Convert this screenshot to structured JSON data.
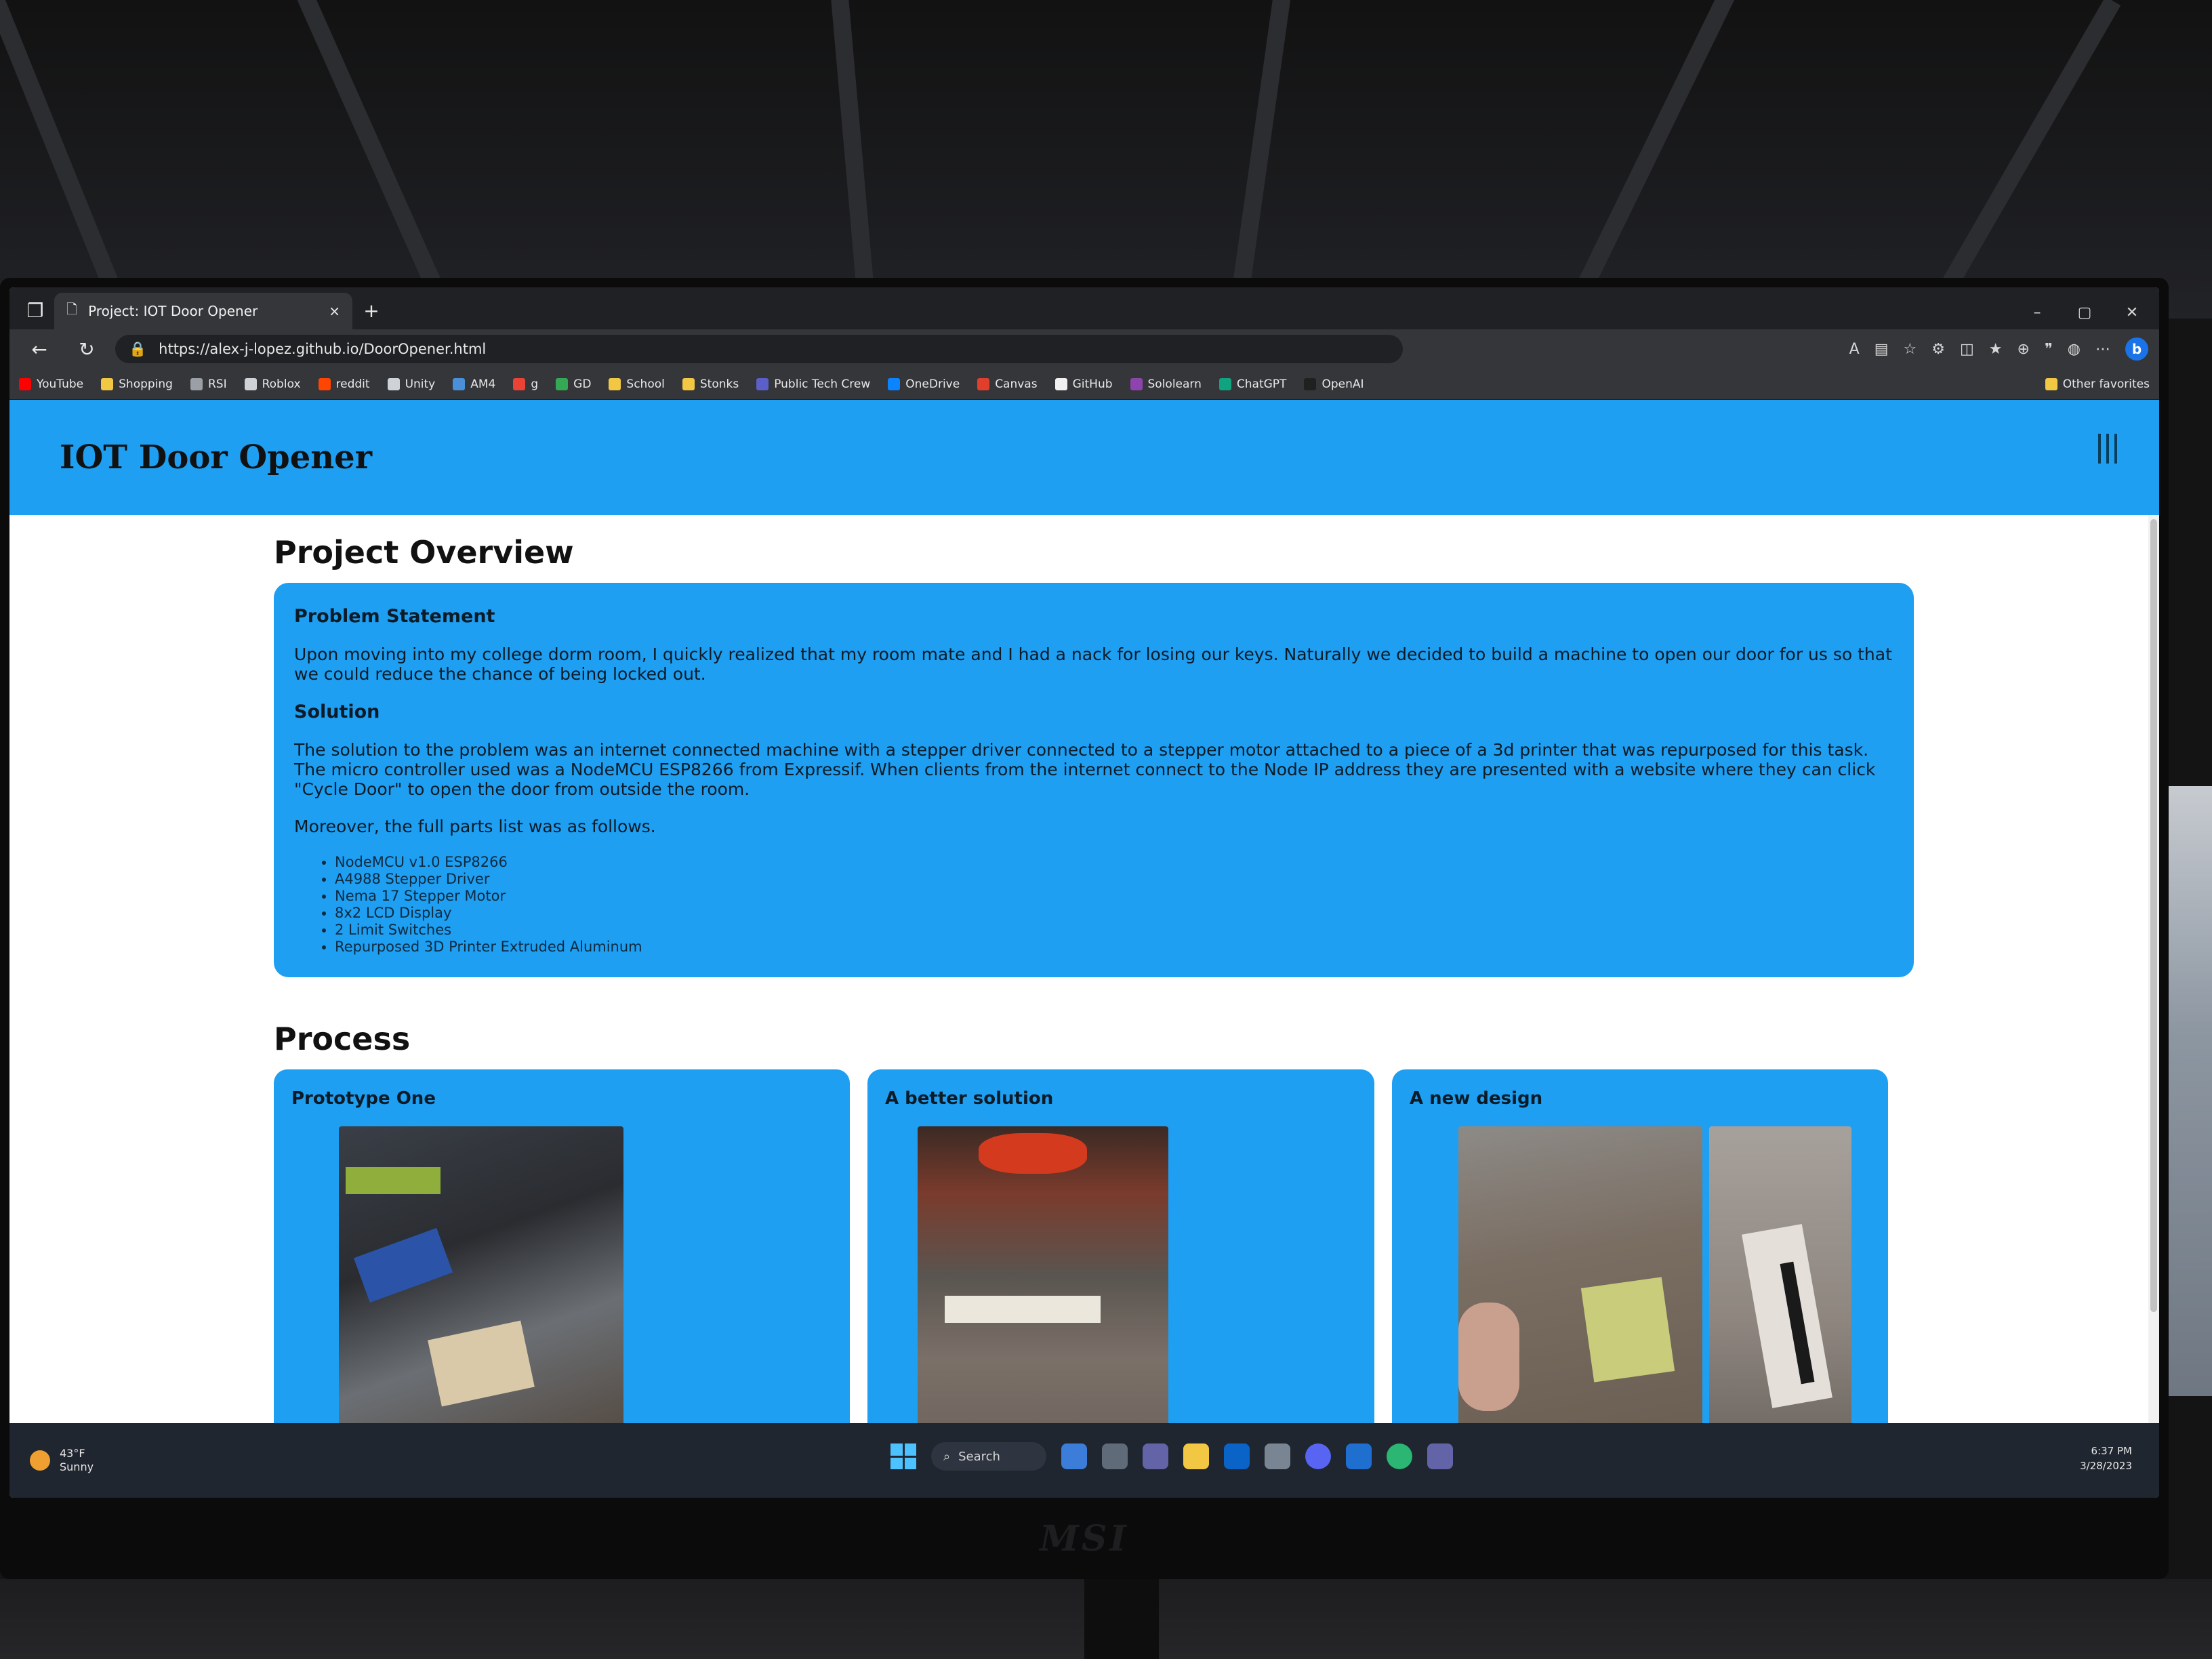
{
  "browser": {
    "tab_title": "Project: IOT Door Opener",
    "tab_close": "×",
    "new_tab": "+",
    "url": "https://alex-j-lopez.github.io/DoorOpener.html",
    "window_controls": [
      "–",
      "▢",
      "✕"
    ],
    "profile_letter": "b",
    "bookmarks": [
      {
        "label": "YouTube",
        "color": "#ff0000"
      },
      {
        "label": "Shopping",
        "color": "#f2c744"
      },
      {
        "label": "RSI",
        "color": "#9aa0a6"
      },
      {
        "label": "Roblox",
        "color": "#cfd2d6"
      },
      {
        "label": "reddit",
        "color": "#ff4500"
      },
      {
        "label": "Unity",
        "color": "#cfd2d6"
      },
      {
        "label": "AM4",
        "color": "#4a90d9"
      },
      {
        "label": "g",
        "color": "#ea4335"
      },
      {
        "label": "GD",
        "color": "#34a853"
      },
      {
        "label": "School",
        "color": "#f2c744"
      },
      {
        "label": "Stonks",
        "color": "#f2c744"
      },
      {
        "label": "Public Tech Crew",
        "color": "#5b5fc7"
      },
      {
        "label": "OneDrive",
        "color": "#0a84ff"
      },
      {
        "label": "Canvas",
        "color": "#e13f2b"
      },
      {
        "label": "GitHub",
        "color": "#f0f0f0"
      },
      {
        "label": "Sololearn",
        "color": "#8e44ad"
      },
      {
        "label": "ChatGPT",
        "color": "#10a37f"
      },
      {
        "label": "OpenAI",
        "color": "#202020"
      }
    ],
    "other_favorites": "Other favorites"
  },
  "site": {
    "title": "IOT Door Opener",
    "overview": {
      "heading": "Project Overview",
      "problem_title": "Problem Statement",
      "problem_text": "Upon moving into my college dorm room, I quickly realized that my room mate and I had a nack for losing our keys. Naturally we decided to build a machine to open our door for us so that we could reduce the chance of being locked out.",
      "solution_title": "Solution",
      "solution_text": "The solution to the problem was an internet connected machine with a stepper driver connected to a stepper motor attached to a piece of a 3d printer that was repurposed for this task. The micro controller used was a NodeMCU ESP8266 from Expressif. When clients from the internet connect to the Node IP address they are presented with a website where they can click \"Cycle Door\" to open the door from outside the room.",
      "parts_intro": "Moreover, the full parts list was as follows.",
      "parts": [
        "NodeMCU v1.0 ESP8266",
        "A4988 Stepper Driver",
        "Nema 17 Stepper Motor",
        "8x2 LCD Display",
        "2 Limit Switches",
        "Repurposed 3D Printer Extruded Aluminum"
      ]
    },
    "process": {
      "heading": "Process",
      "cards": [
        {
          "title": "Prototype One"
        },
        {
          "title": "A better solution"
        },
        {
          "title": "A new design"
        }
      ]
    }
  },
  "taskbar": {
    "weather_temp": "43°F",
    "weather_desc": "Sunny",
    "search_label": "Search",
    "time": "6:37 PM",
    "date": "3/28/2023"
  },
  "monitor_brand": "MSI"
}
